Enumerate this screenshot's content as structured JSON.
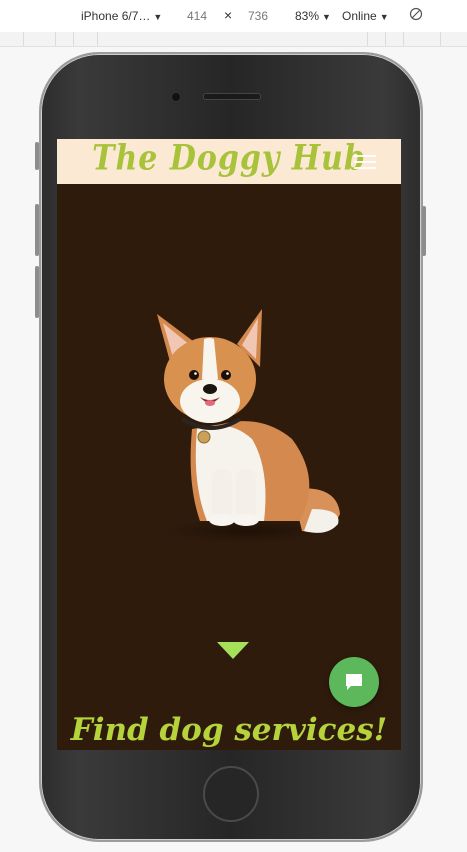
{
  "devtools": {
    "device": "iPhone 6/7…",
    "width": "414",
    "dimension_separator": "×",
    "height": "736",
    "zoom": "83%",
    "network": "Online"
  },
  "site": {
    "logo": "The Doggy Hub",
    "headline": "Find dog services!"
  },
  "colors": {
    "header_bg": "#fbe9d4",
    "page_bg": "#2f1b0c",
    "accent": "#b5d33a",
    "chat_button": "#5db85c"
  },
  "icons": {
    "menu": "hamburger-menu-icon",
    "scroll": "triangle-down-icon",
    "chat": "chat-bubble-icon",
    "rotate": "rotate-icon"
  }
}
